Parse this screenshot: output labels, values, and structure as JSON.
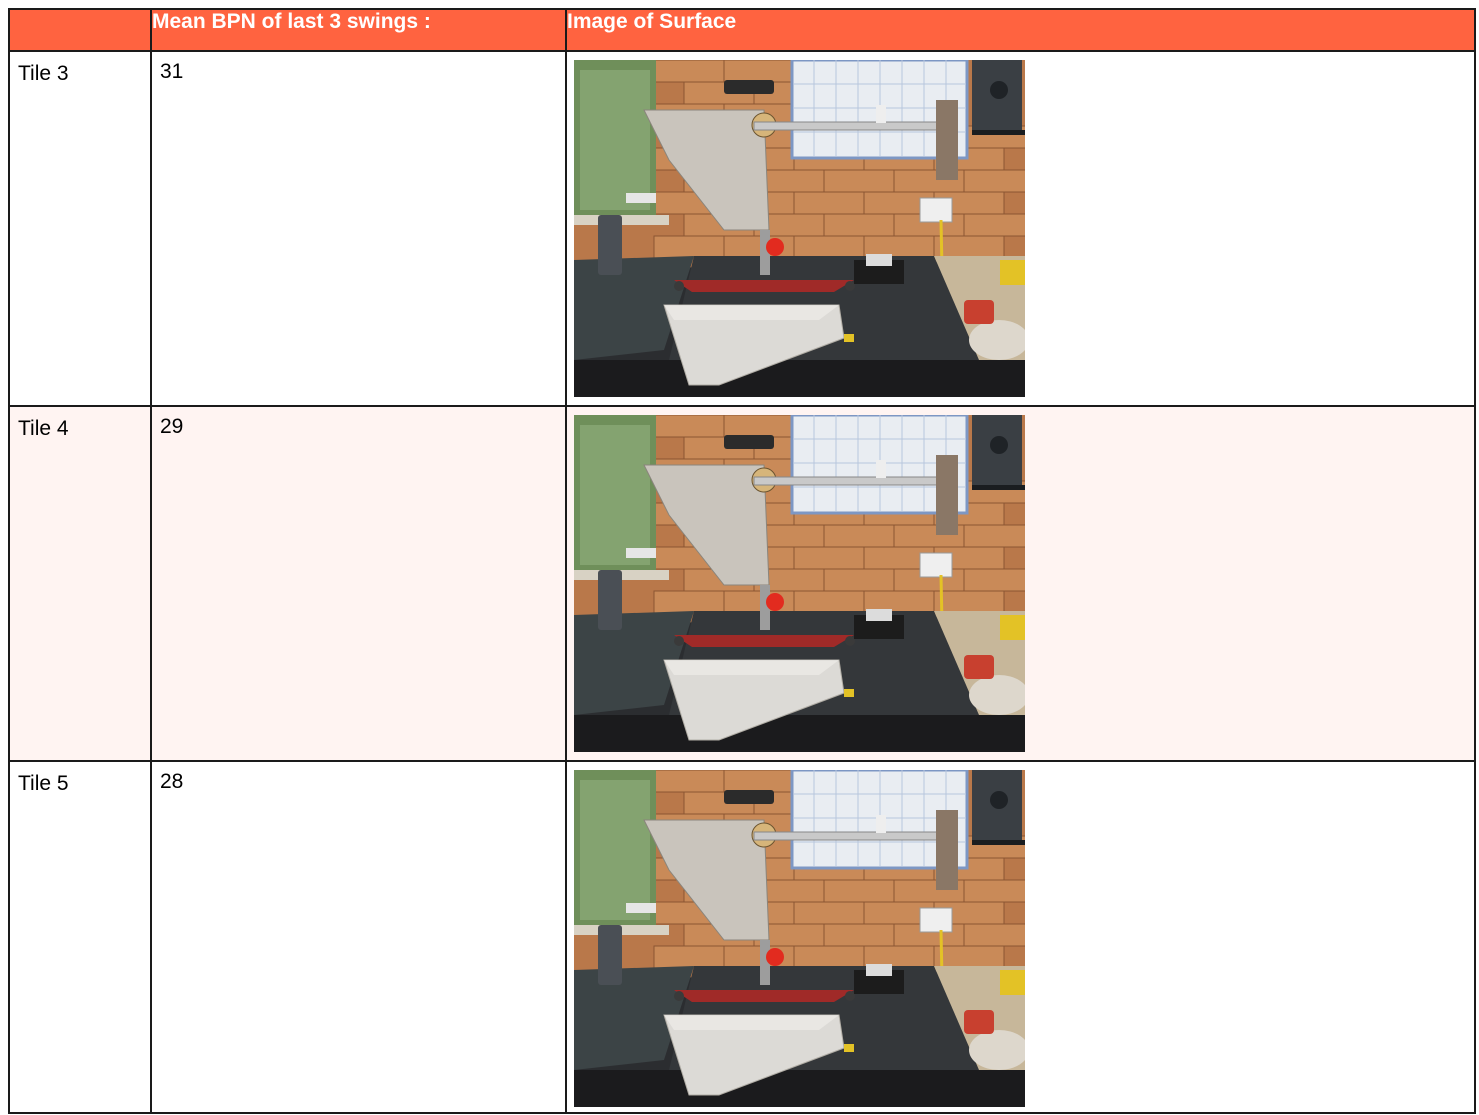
{
  "table": {
    "headers": [
      "",
      "Mean BPN of last 3 swings :",
      "Image of Surface"
    ],
    "rows": [
      {
        "tile": "Tile 3",
        "bpn": "31",
        "image": "pendulum-test-photo"
      },
      {
        "tile": "Tile 4",
        "bpn": "29",
        "image": "pendulum-test-photo"
      },
      {
        "tile": "Tile 5",
        "bpn": "28",
        "image": "pendulum-test-photo"
      }
    ]
  },
  "colors": {
    "header_bg": "#ff6340",
    "header_text": "#ffffff",
    "alt_row_bg": "#fff4f2",
    "border": "#1a1a1a"
  }
}
